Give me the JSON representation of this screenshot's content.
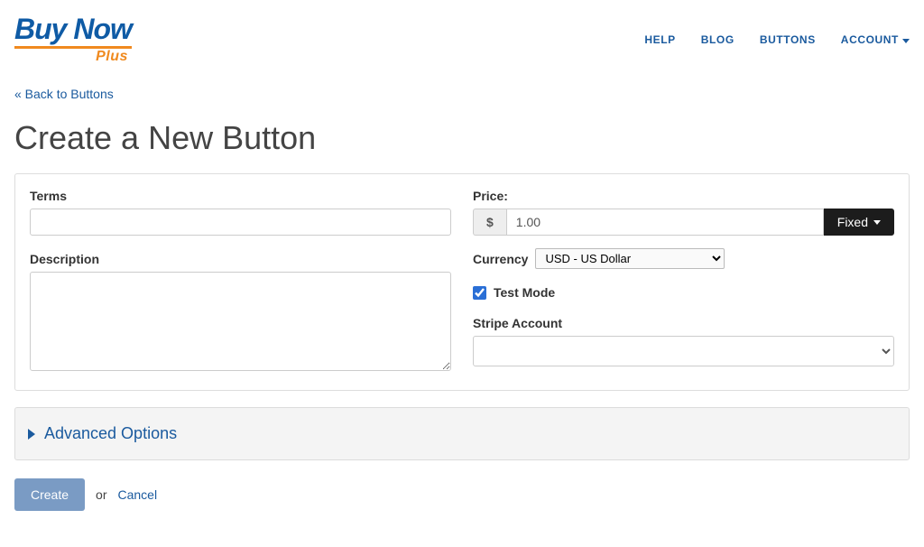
{
  "logo": {
    "main": "Buy Now",
    "plus": "Plus"
  },
  "nav": {
    "help": "HELP",
    "blog": "BLOG",
    "buttons": "BUTTONS",
    "account": "ACCOUNT"
  },
  "back_link": "« Back to Buttons",
  "page_title": "Create a New Button",
  "form": {
    "terms_label": "Terms",
    "terms_value": "",
    "description_label": "Description",
    "description_value": "",
    "price_label": "Price:",
    "price_symbol": "$",
    "price_value": "1.00",
    "price_type_label": "Fixed",
    "currency_label": "Currency",
    "currency_selected": "USD - US Dollar",
    "test_mode_label": "Test Mode",
    "test_mode_checked": true,
    "stripe_label": "Stripe Account",
    "stripe_selected": ""
  },
  "advanced_label": "Advanced Options",
  "actions": {
    "create": "Create",
    "or": "or",
    "cancel": "Cancel"
  }
}
